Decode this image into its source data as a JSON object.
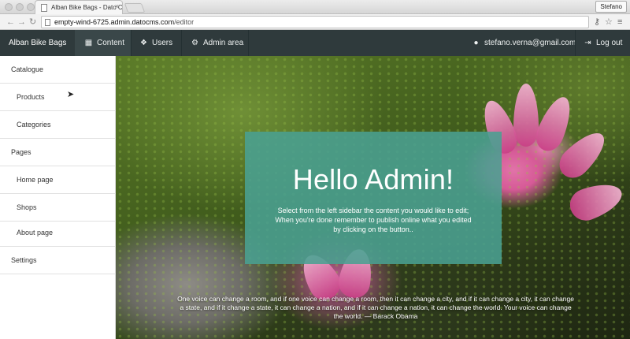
{
  "browser": {
    "tab_title": "Alban Bike Bags - Dato Cl",
    "tab_close": "×",
    "profile_name": "Stefano",
    "url_host": "empty-wind-6725.admin.datocms.com",
    "url_path": "/editor"
  },
  "app": {
    "brand": "Alban Bike Bags",
    "nav": {
      "content": "Content",
      "users": "Users",
      "admin_area": "Admin area",
      "email": "stefano.verna@gmail.com",
      "logout": "Log out"
    },
    "icons": {
      "content": "grid-icon",
      "users": "users-icon",
      "admin": "gear-icon",
      "user": "user-icon",
      "logout": "logout-icon"
    }
  },
  "sidebar": {
    "items": [
      {
        "label": "Catalogue",
        "kind": "section"
      },
      {
        "label": "Products",
        "kind": "child"
      },
      {
        "label": "Categories",
        "kind": "child"
      },
      {
        "label": "Pages",
        "kind": "section"
      },
      {
        "label": "Home page",
        "kind": "child"
      },
      {
        "label": "Shops",
        "kind": "child"
      },
      {
        "label": "About page",
        "kind": "child"
      },
      {
        "label": "Settings",
        "kind": "section"
      }
    ]
  },
  "hero": {
    "title": "Hello Admin!",
    "line1": "Select from the left sidebar the content you would like to edit;",
    "line2": "When you're done remember to publish online what you edited",
    "line3": "by clicking on the button.."
  },
  "quote": {
    "line1": "One voice can change a room, and if one voice can change a room, then it can change a city, and if it can change a city, it can change",
    "line2": "a state, and if it change a state, it can change a nation, and if it can change a nation, it can change the world. Your voice can change",
    "line3": "the world. — Barack Obama"
  },
  "colors": {
    "navbar": "#2f3a3c",
    "hero_card": "#4aa092"
  }
}
